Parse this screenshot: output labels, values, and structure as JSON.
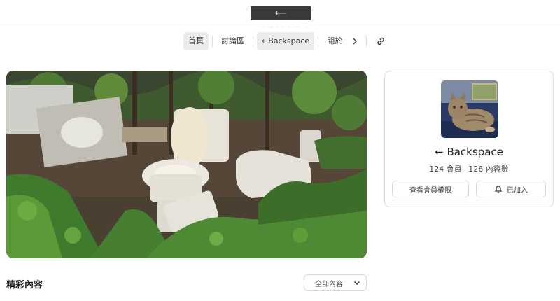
{
  "header": {
    "brand": "⟵ Backspace"
  },
  "nav": {
    "items": [
      {
        "label": "首頁",
        "active": true
      },
      {
        "label": "討論區",
        "active": false
      },
      {
        "label": "←Backspace",
        "active": true
      },
      {
        "label": "關於",
        "active": false
      }
    ],
    "more_icon": "chevron-right-icon",
    "link_icon": "link-icon"
  },
  "community": {
    "name": "← Backspace",
    "members": "124 會員",
    "posts": "126 內容數",
    "permissions_button": "查看會員權限",
    "joined_button": "已加入",
    "joined_icon": "bell-icon"
  },
  "content": {
    "section_title": "精彩內容",
    "filter_value": "全部內容"
  }
}
